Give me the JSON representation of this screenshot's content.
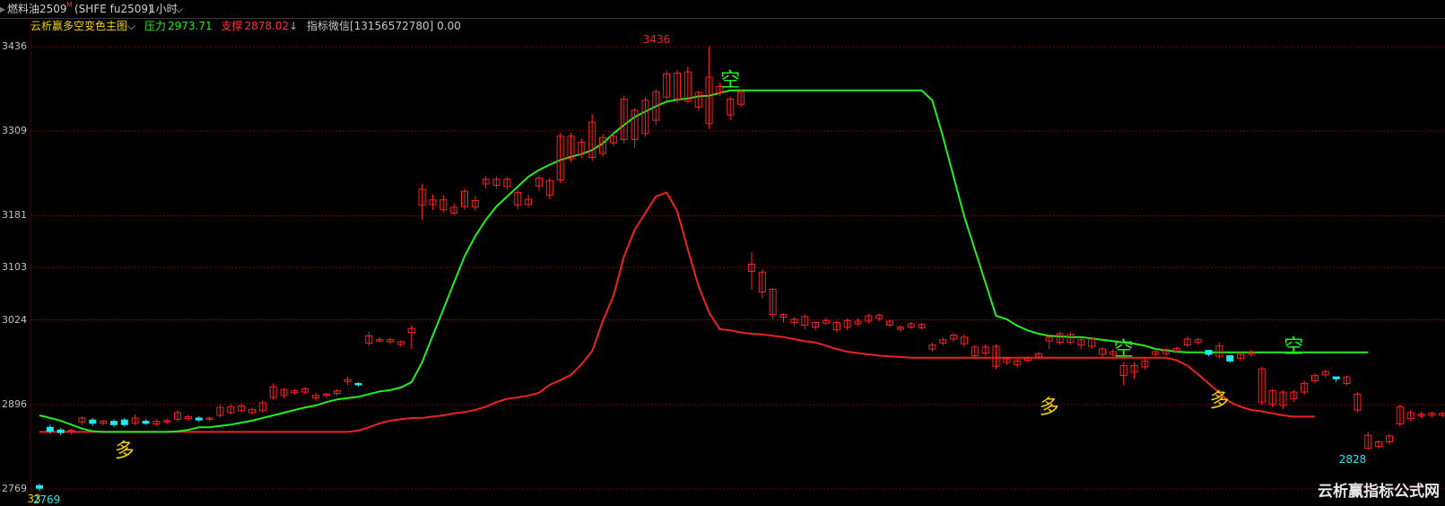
{
  "header": {
    "symbol_name": "燃料油2509",
    "superscript": "M",
    "symbol_code": "(SHFE fu2509)",
    "period": "1小时",
    "chevron_icon": "chevron-down-icon"
  },
  "indicator": {
    "name": "云析赢多空变色主图",
    "resistance_label": "压力",
    "resistance_value": "2973.71",
    "support_label": "支撑",
    "support_value": "2878.02",
    "contact_text": "指标微信[13156572780] 0.00"
  },
  "colors": {
    "bull": "#ff2020",
    "bear": "#20e8f0",
    "resistance_line": "#22ee22",
    "support_line": "#ee2222",
    "grid": "#7a0000",
    "bull_signal": "#f0d000",
    "bear_signal": "#22ee22"
  },
  "watermark": "云析赢指标公式网",
  "chart_data": {
    "type": "candlestick",
    "y_ticks": [
      "3436",
      "3309",
      "3181",
      "3103",
      "3024",
      "2896",
      "2769"
    ],
    "y_range": [
      2760,
      3460
    ],
    "high_label": "3436",
    "low_label": "2828",
    "left_label": "2769",
    "left_label_overlay": "33",
    "signals": [
      {
        "text": "多",
        "bar": 8,
        "price": 2852,
        "type": "bull"
      },
      {
        "text": "空",
        "bar": 65,
        "price": 3384,
        "type": "bear"
      },
      {
        "text": "多",
        "bar": 95,
        "price": 2918,
        "type": "bull"
      },
      {
        "text": "空",
        "bar": 102,
        "price": 2978,
        "type": "bear"
      },
      {
        "text": "多",
        "bar": 111,
        "price": 2928,
        "type": "bull"
      },
      {
        "text": "空",
        "bar": 118,
        "price": 2982,
        "type": "bear"
      }
    ],
    "resistance": [
      2880,
      2876,
      2872,
      2866,
      2860,
      2856,
      2855,
      2855,
      2855,
      2855,
      2855,
      2855,
      2855,
      2856,
      2858,
      2862,
      2862,
      2864,
      2866,
      2869,
      2872,
      2876,
      2880,
      2884,
      2888,
      2892,
      2895,
      2900,
      2904,
      2906,
      2908,
      2912,
      2916,
      2918,
      2922,
      2930,
      2960,
      3000,
      3040,
      3080,
      3120,
      3150,
      3175,
      3195,
      3210,
      3225,
      3240,
      3250,
      3258,
      3265,
      3270,
      3274,
      3280,
      3290,
      3305,
      3318,
      3330,
      3338,
      3346,
      3353,
      3356,
      3358,
      3361,
      3362,
      3366,
      3370,
      3370,
      3370,
      3370,
      3370,
      3370,
      3370,
      3370,
      3370,
      3370,
      3370,
      3370,
      3370,
      3370,
      3370,
      3370,
      3370,
      3370,
      3370,
      3355,
      3300,
      3240,
      3180,
      3130,
      3080,
      3030,
      3025,
      3015,
      3008,
      3003,
      3000,
      2999,
      2998,
      2998,
      2996,
      2994,
      2992,
      2990,
      2988,
      2985,
      2980,
      2978,
      2976,
      2975,
      2975,
      2975,
      2975,
      2975,
      2975,
      2975,
      2975,
      2975,
      2975,
      2975,
      2975,
      2975,
      2975,
      2975,
      2975,
      2975,
      2975
    ],
    "support": [
      2855,
      2855,
      2855,
      2855,
      2855,
      2855,
      2855,
      2855,
      2855,
      2855,
      2855,
      2855,
      2855,
      2855,
      2855,
      2855,
      2855,
      2855,
      2855,
      2855,
      2855,
      2855,
      2855,
      2855,
      2855,
      2855,
      2855,
      2855,
      2855,
      2855,
      2857,
      2862,
      2868,
      2872,
      2874,
      2876,
      2876,
      2878,
      2880,
      2883,
      2885,
      2888,
      2893,
      2900,
      2905,
      2907,
      2910,
      2914,
      2926,
      2933,
      2941,
      2957,
      2977,
      3022,
      3060,
      3120,
      3160,
      3185,
      3210,
      3216,
      3188,
      3130,
      3075,
      3035,
      3010,
      3008,
      3005,
      3003,
      3002,
      3000,
      2998,
      2995,
      2992,
      2990,
      2985,
      2980,
      2976,
      2974,
      2972,
      2970,
      2969,
      2968,
      2967,
      2967,
      2967,
      2967,
      2967,
      2967,
      2967,
      2967,
      2967,
      2967,
      2967,
      2967,
      2967,
      2967,
      2967,
      2967,
      2967,
      2967,
      2967,
      2967,
      2967,
      2967,
      2967,
      2967,
      2967,
      2963,
      2955,
      2942,
      2928,
      2914,
      2900,
      2893,
      2888,
      2886,
      2883,
      2880,
      2878,
      2878,
      2878
    ],
    "candles": [
      [
        2774,
        2770,
        2777,
        2766
      ],
      [
        2862,
        2856,
        2866,
        2852
      ],
      [
        2858,
        2854,
        2861,
        2850
      ],
      [
        2856,
        2858,
        2860,
        2851
      ],
      [
        2870,
        2876,
        2879,
        2865
      ],
      [
        2873,
        2868,
        2876,
        2864
      ],
      [
        2868,
        2871,
        2873,
        2865
      ],
      [
        2871,
        2866,
        2874,
        2863
      ],
      [
        2873,
        2866,
        2876,
        2863
      ],
      [
        2868,
        2876,
        2881,
        2865
      ],
      [
        2871,
        2868,
        2874,
        2866
      ],
      [
        2867,
        2871,
        2874,
        2864
      ],
      [
        2870,
        2872,
        2875,
        2867
      ],
      [
        2874,
        2884,
        2888,
        2870
      ],
      [
        2875,
        2878,
        2881,
        2871
      ],
      [
        2876,
        2873,
        2879,
        2870
      ],
      [
        2874,
        2876,
        2878,
        2871
      ],
      [
        2880,
        2892,
        2896,
        2877
      ],
      [
        2884,
        2893,
        2898,
        2881
      ],
      [
        2887,
        2894,
        2898,
        2885
      ],
      [
        2884,
        2889,
        2892,
        2881
      ],
      [
        2887,
        2899,
        2903,
        2884
      ],
      [
        2907,
        2923,
        2928,
        2903
      ],
      [
        2910,
        2919,
        2921,
        2906
      ],
      [
        2914,
        2917,
        2920,
        2911
      ],
      [
        2915,
        2920,
        2923,
        2912
      ],
      [
        2906,
        2910,
        2914,
        2902
      ],
      [
        2910,
        2912,
        2914,
        2906
      ],
      [
        2913,
        2917,
        2920,
        2909
      ],
      [
        2931,
        2934,
        2938,
        2925
      ],
      [
        2928,
        2926,
        2930,
        2923
      ],
      [
        2989,
        3000,
        3006,
        2984
      ],
      [
        2994,
        2994,
        2998,
        2990
      ],
      [
        2991,
        2994,
        2997,
        2987
      ],
      [
        2987,
        2991,
        2993,
        2983
      ],
      [
        3005,
        3011,
        3016,
        2980
      ],
      [
        3197,
        3221,
        3229,
        3175
      ],
      [
        3198,
        3205,
        3213,
        3190
      ],
      [
        3190,
        3205,
        3212,
        3186
      ],
      [
        3185,
        3194,
        3200,
        3182
      ],
      [
        3195,
        3218,
        3222,
        3190
      ],
      [
        3194,
        3204,
        3210,
        3188
      ],
      [
        3229,
        3236,
        3241,
        3222
      ],
      [
        3227,
        3236,
        3240,
        3222
      ],
      [
        3225,
        3236,
        3240,
        3220
      ],
      [
        3197,
        3216,
        3221,
        3191
      ],
      [
        3198,
        3206,
        3213,
        3193
      ],
      [
        3226,
        3238,
        3242,
        3218
      ],
      [
        3212,
        3234,
        3238,
        3206
      ],
      [
        3235,
        3301,
        3306,
        3230
      ],
      [
        3267,
        3301,
        3306,
        3262
      ],
      [
        3274,
        3292,
        3297,
        3268
      ],
      [
        3269,
        3322,
        3335,
        3264
      ],
      [
        3275,
        3299,
        3305,
        3270
      ],
      [
        3291,
        3301,
        3306,
        3286
      ],
      [
        3296,
        3357,
        3362,
        3290
      ],
      [
        3296,
        3340,
        3343,
        3283
      ],
      [
        3305,
        3355,
        3360,
        3300
      ],
      [
        3325,
        3368,
        3372,
        3318
      ],
      [
        3360,
        3395,
        3400,
        3355
      ],
      [
        3357,
        3396,
        3401,
        3351
      ],
      [
        3354,
        3398,
        3406,
        3350
      ],
      [
        3345,
        3367,
        3369,
        3340
      ],
      [
        3320,
        3390,
        3436,
        3312
      ],
      [
        3366,
        3376,
        3382,
        3362
      ],
      [
        3333,
        3357,
        3360,
        3325
      ],
      [
        3349,
        3368,
        3372,
        3345
      ],
      [
        3097,
        3108,
        3126,
        3070
      ],
      [
        3066,
        3096,
        3100,
        3056
      ],
      [
        3032,
        3070,
        3072,
        3025
      ],
      [
        3028,
        3032,
        3034,
        3020
      ],
      [
        3020,
        3025,
        3028,
        3015
      ],
      [
        3016,
        3029,
        3032,
        3010
      ],
      [
        3013,
        3020,
        3022,
        3008
      ],
      [
        3019,
        3023,
        3027,
        3016
      ],
      [
        3009,
        3020,
        3023,
        3005
      ],
      [
        3013,
        3023,
        3026,
        3009
      ],
      [
        3018,
        3022,
        3026,
        3015
      ],
      [
        3022,
        3030,
        3033,
        3018
      ],
      [
        3026,
        3031,
        3034,
        3022
      ],
      [
        3016,
        3022,
        3025,
        3013
      ],
      [
        3010,
        3013,
        3016,
        3006
      ],
      [
        3013,
        3018,
        3021,
        3010
      ],
      [
        3012,
        3017,
        3020,
        3009
      ],
      [
        2980,
        2986,
        2990,
        2976
      ],
      [
        2989,
        2994,
        2998,
        2985
      ],
      [
        2995,
        3001,
        3004,
        2991
      ],
      [
        2988,
        2998,
        3003,
        2983
      ],
      [
        2970,
        2983,
        2986,
        2966
      ],
      [
        2974,
        2983,
        2987,
        2970
      ],
      [
        2954,
        2984,
        2987,
        2950
      ],
      [
        2960,
        2965,
        2968,
        2956
      ],
      [
        2956,
        2962,
        2966,
        2952
      ],
      [
        2963,
        2966,
        2969,
        2960
      ],
      [
        2968,
        2973,
        2976,
        2965
      ],
      [
        2992,
        2998,
        3001,
        2980
      ],
      [
        2990,
        3003,
        3006,
        2986
      ],
      [
        2990,
        3002,
        3006,
        2986
      ],
      [
        2986,
        2994,
        2997,
        2980
      ],
      [
        2984,
        2995,
        2998,
        2980
      ],
      [
        2972,
        2980,
        2983,
        2968
      ],
      [
        2972,
        2976,
        2980,
        2968
      ],
      [
        2940,
        2955,
        2960,
        2925
      ],
      [
        2945,
        2955,
        2960,
        2935
      ],
      [
        2953,
        2962,
        2966,
        2949
      ],
      [
        2972,
        2976,
        2980,
        2969
      ],
      [
        2973,
        2979,
        2982,
        2970
      ],
      [
        2977,
        2981,
        2984,
        2974
      ],
      [
        2986,
        2995,
        2999,
        2983
      ],
      [
        2990,
        2994,
        2997,
        2986
      ],
      [
        2978,
        2972,
        2975,
        2969
      ],
      [
        2969,
        2985,
        2990,
        2965
      ],
      [
        2970,
        2962,
        2965,
        2959
      ],
      [
        2966,
        2972,
        2976,
        2962
      ],
      [
        2972,
        2976,
        2979,
        2968
      ],
      [
        2900,
        2950,
        2953,
        2895
      ],
      [
        2897,
        2917,
        2920,
        2892
      ],
      [
        2895,
        2915,
        2918,
        2890
      ],
      [
        2905,
        2915,
        2918,
        2900
      ],
      [
        2915,
        2928,
        2932,
        2911
      ],
      [
        2932,
        2940,
        2943,
        2928
      ],
      [
        2941,
        2946,
        2949,
        2937
      ],
      [
        2938,
        2935,
        2938,
        2930
      ],
      [
        2928,
        2938,
        2940,
        2925
      ],
      [
        2888,
        2912,
        2915,
        2884
      ],
      [
        2830,
        2850,
        2855,
        2828
      ],
      [
        2833,
        2840,
        2842,
        2830
      ],
      [
        2840,
        2849,
        2852,
        2836
      ],
      [
        2867,
        2893,
        2896,
        2863
      ],
      [
        2875,
        2884,
        2888,
        2871
      ],
      [
        2879,
        2882,
        2885,
        2876
      ],
      [
        2880,
        2883,
        2886,
        2877
      ],
      [
        2880,
        2883,
        2886,
        2877
      ]
    ]
  }
}
